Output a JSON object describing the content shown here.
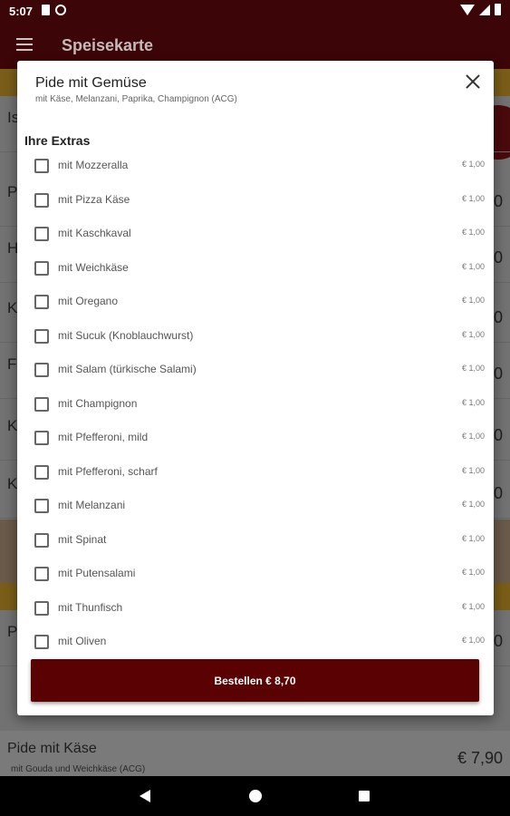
{
  "status_bar": {
    "time": "5:07"
  },
  "app_bar": {
    "title": "Speisekarte"
  },
  "background_list": {
    "items": [
      {
        "name": "Is",
        "sub": "",
        "price": ""
      },
      {
        "name": "P",
        "sub": "",
        "price": "0"
      },
      {
        "name": "H",
        "sub": "",
        "price": "0"
      },
      {
        "name": "K",
        "sub": "",
        "price": "0"
      },
      {
        "name": "F",
        "sub": "",
        "price": "0"
      },
      {
        "name": "K",
        "sub": "",
        "price": "0"
      },
      {
        "name": "K",
        "sub": "",
        "price": "0"
      },
      {
        "name": "P",
        "sub": "",
        "price": "0"
      }
    ],
    "bottom_item": {
      "name": "Pide mit Käse",
      "sub": "mit Gouda und Weichkäse (ACG)",
      "price": "€ 7,90"
    }
  },
  "dialog": {
    "title": "Pide mit Gemüse",
    "subtitle": "mit Käse, Melanzani, Paprika, Champignon (ACG)",
    "extras_heading": "Ihre Extras",
    "extras": [
      {
        "label": "mit Mozzeralla",
        "price": "€ 1,00"
      },
      {
        "label": "mit Pizza Käse",
        "price": "€ 1,00"
      },
      {
        "label": "mit Kaschkaval",
        "price": "€ 1,00"
      },
      {
        "label": "mit Weichkäse",
        "price": "€ 1,00"
      },
      {
        "label": "mit Oregano",
        "price": "€ 1,00"
      },
      {
        "label": "mit Sucuk (Knoblauchwurst)",
        "price": "€ 1,00"
      },
      {
        "label": "mit Salam (türkische Salami)",
        "price": "€ 1,00"
      },
      {
        "label": "mit Champignon",
        "price": "€ 1,00"
      },
      {
        "label": "mit Pfefferoni, mild",
        "price": "€ 1,00"
      },
      {
        "label": "mit Pfefferoni, scharf",
        "price": "€ 1,00"
      },
      {
        "label": "mit Melanzani",
        "price": "€ 1,00"
      },
      {
        "label": "mit Spinat",
        "price": "€ 1,00"
      },
      {
        "label": "mit Putensalami",
        "price": "€ 1,00"
      },
      {
        "label": "mit Thunfisch",
        "price": "€ 1,00"
      },
      {
        "label": "mit Oliven",
        "price": "€ 1,00"
      }
    ],
    "order_button": "Bestellen € 8,70"
  },
  "colors": {
    "brand": "#5a0103",
    "app_bar": "#3c0507",
    "accent_band": "#c9a028"
  }
}
